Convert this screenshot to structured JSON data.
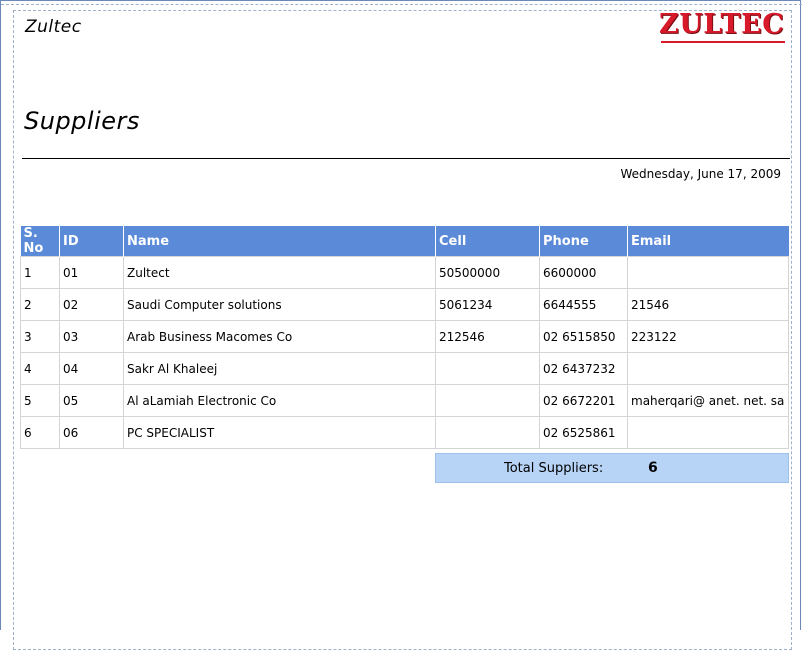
{
  "header": {
    "company_name": "Zultec",
    "logo_text": "ZULTEC",
    "brand_color": "#d8192a"
  },
  "report": {
    "title": "Suppliers",
    "date": "Wednesday, June 17, 2009"
  },
  "table": {
    "header_color": "#5a8ad8",
    "columns": [
      "S. No",
      "ID",
      "Name",
      "Cell",
      "Phone",
      "Email"
    ],
    "rows": [
      [
        "1",
        "01",
        "Zultect",
        "50500000",
        "6600000",
        ""
      ],
      [
        "2",
        "02",
        "Saudi Computer solutions",
        "5061234",
        "6644555",
        "21546"
      ],
      [
        "3",
        "03",
        "Arab Business Macomes Co",
        "212546",
        "02 6515850",
        "223122"
      ],
      [
        "4",
        "04",
        "Sakr Al Khaleej",
        "",
        "02 6437232",
        ""
      ],
      [
        "5",
        "05",
        "Al  aLamiah Electronic Co",
        "",
        "02 6672201",
        "maherqari@ anet. net. sa"
      ],
      [
        "6",
        "06",
        "PC SPECIALIST",
        "",
        "02 6525861",
        ""
      ]
    ]
  },
  "summary": {
    "label": "Total Suppliers:",
    "value": "6",
    "background_color": "#b7d4f6"
  }
}
